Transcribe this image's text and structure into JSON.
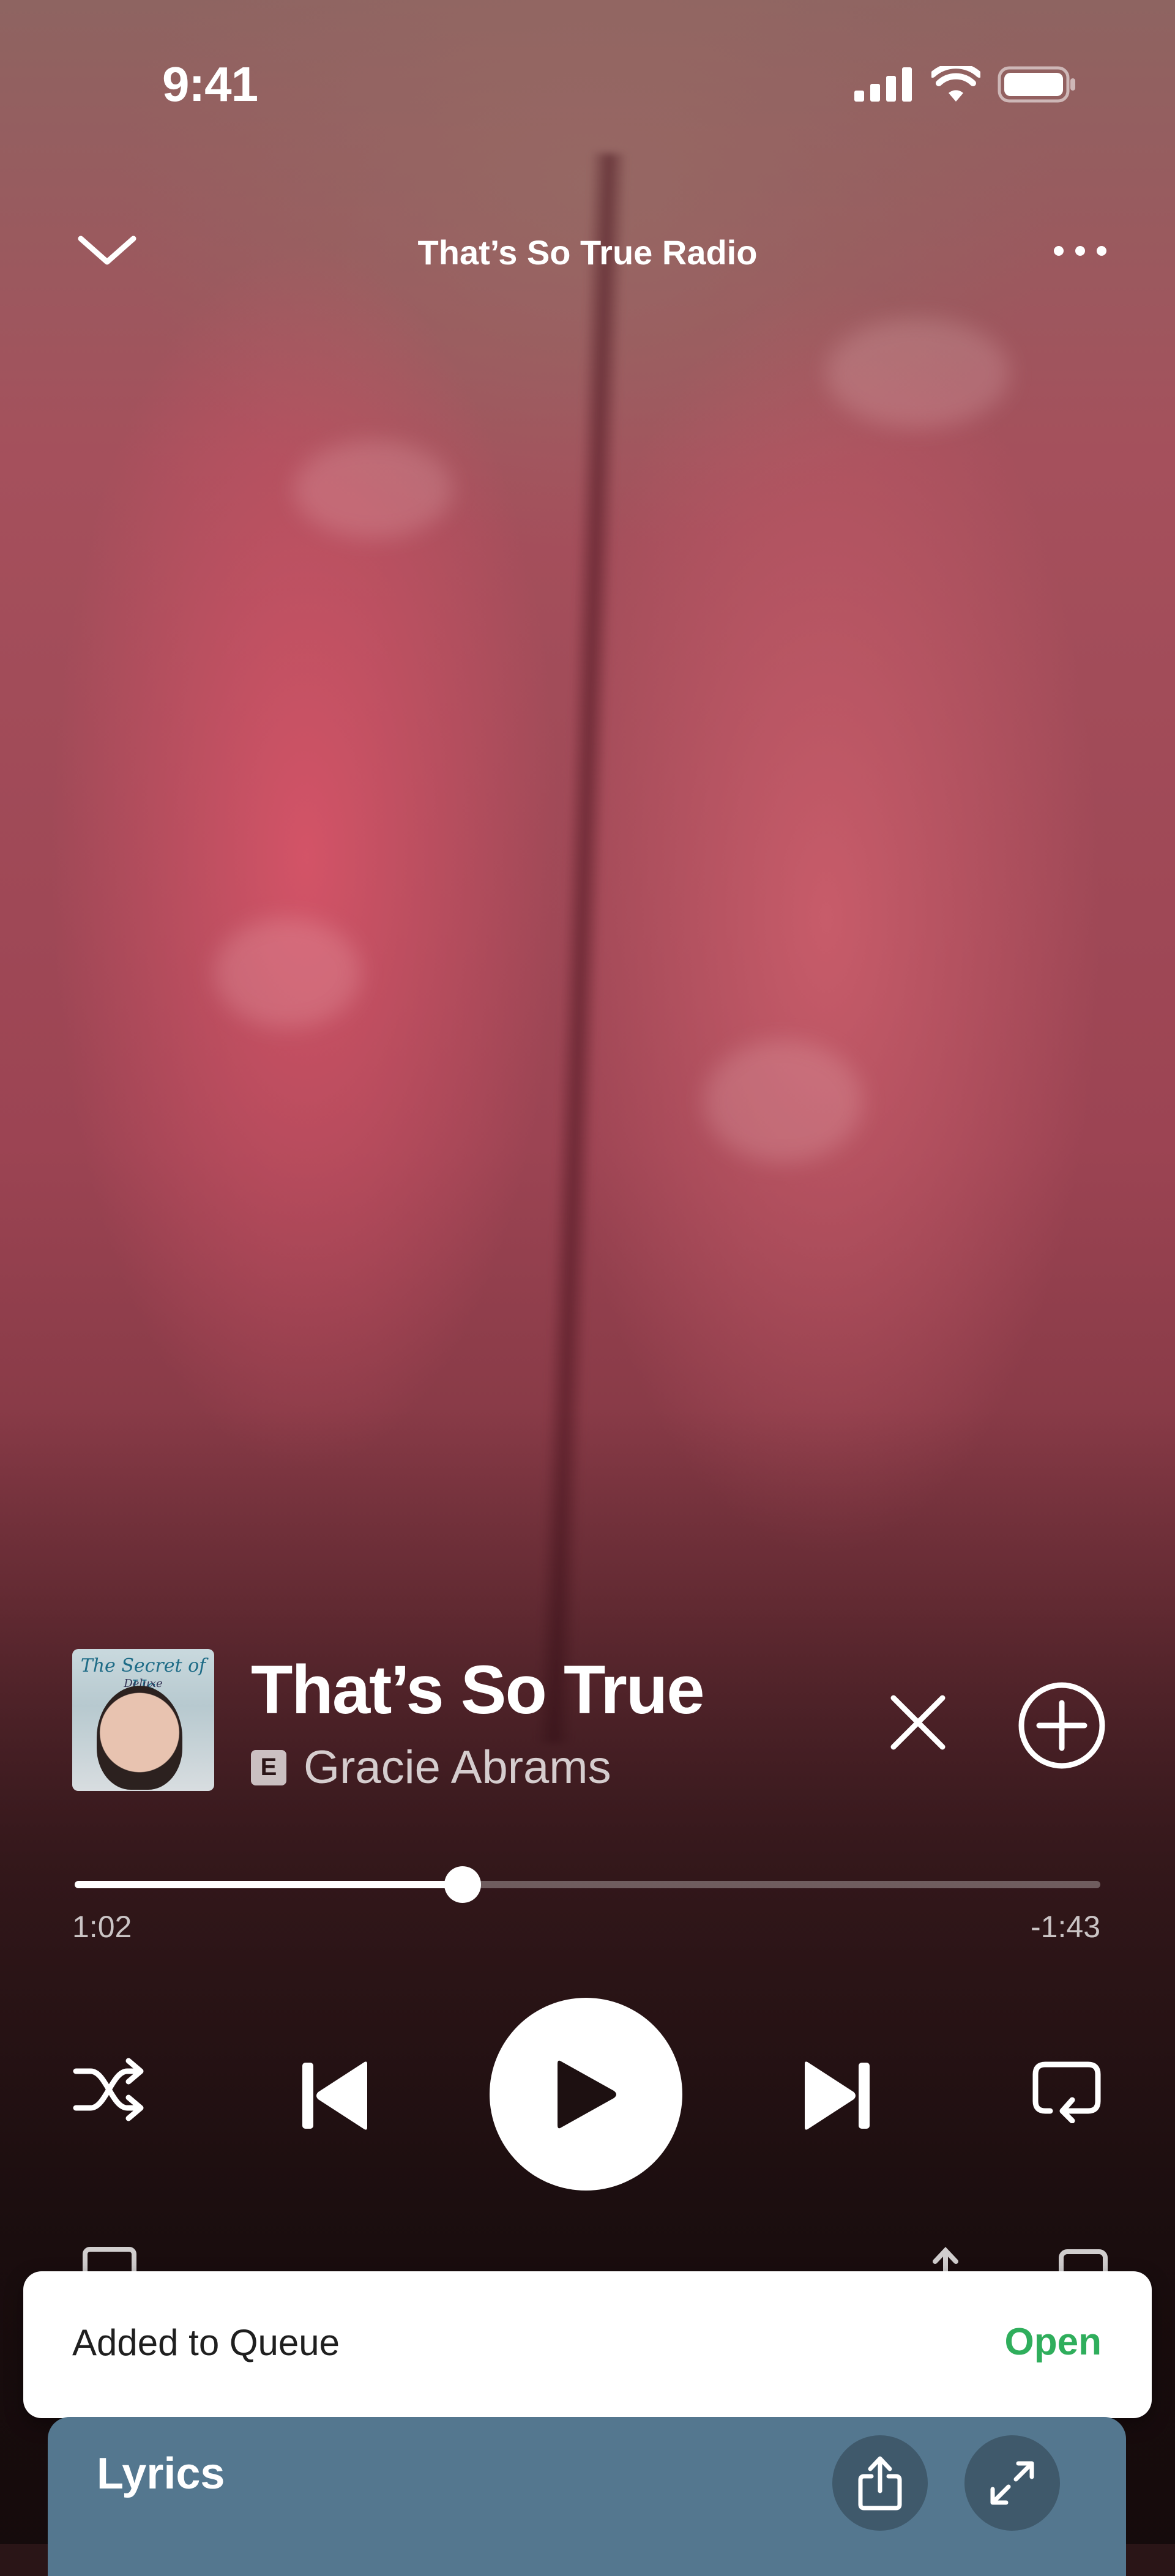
{
  "status_bar": {
    "time": "9:41",
    "icons": [
      "cellular-signal-icon",
      "wifi-icon",
      "battery-icon"
    ]
  },
  "header": {
    "title": "That’s So True Radio",
    "left_icon": "chevron-down-icon",
    "right_icon": "more-icon"
  },
  "track": {
    "album_art": {
      "script_title": "The Secret of Us",
      "edition": "Deluxe"
    },
    "title": "That’s So True",
    "explicit_badge": "E",
    "artist": "Gracie Abrams",
    "actions": [
      "close-icon",
      "add-circle-icon"
    ]
  },
  "playback": {
    "elapsed": "1:02",
    "remaining": "-1:43",
    "progress_fraction": 0.378,
    "state": "paused"
  },
  "controls": [
    "shuffle-icon",
    "previous-icon",
    "play-icon",
    "next-icon",
    "repeat-icon"
  ],
  "toast": {
    "message": "Added to Queue",
    "action": "Open",
    "action_color": "#2fae5c"
  },
  "lyrics_card": {
    "label": "Lyrics",
    "background": "#54778f",
    "icons": [
      "share-icon",
      "expand-icon"
    ]
  }
}
